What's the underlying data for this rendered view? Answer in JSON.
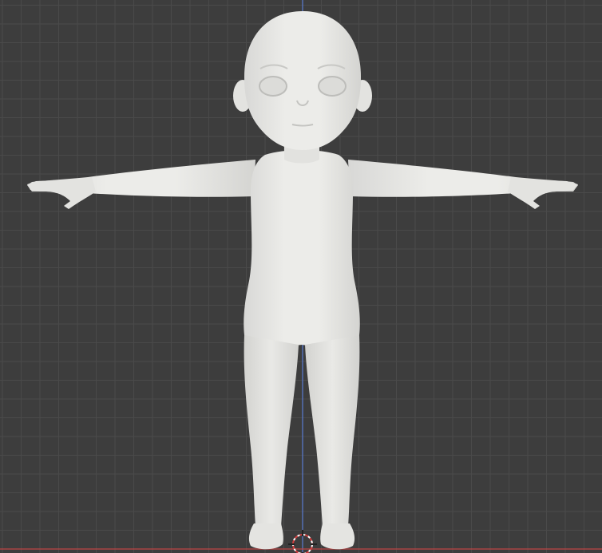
{
  "viewport": {
    "background": "#3d3d3d",
    "grid_minor_color": "#4a4a4a",
    "grid_major_color": "#555555",
    "z_axis_color": "#5a7bd0",
    "x_axis_color": "#c04545"
  },
  "model": {
    "pose": "t-pose",
    "material_color": "#e6e6e4",
    "shadow_color": "#cfcfcc"
  },
  "icons": {
    "origin_cursor": "3d-cursor-icon"
  }
}
